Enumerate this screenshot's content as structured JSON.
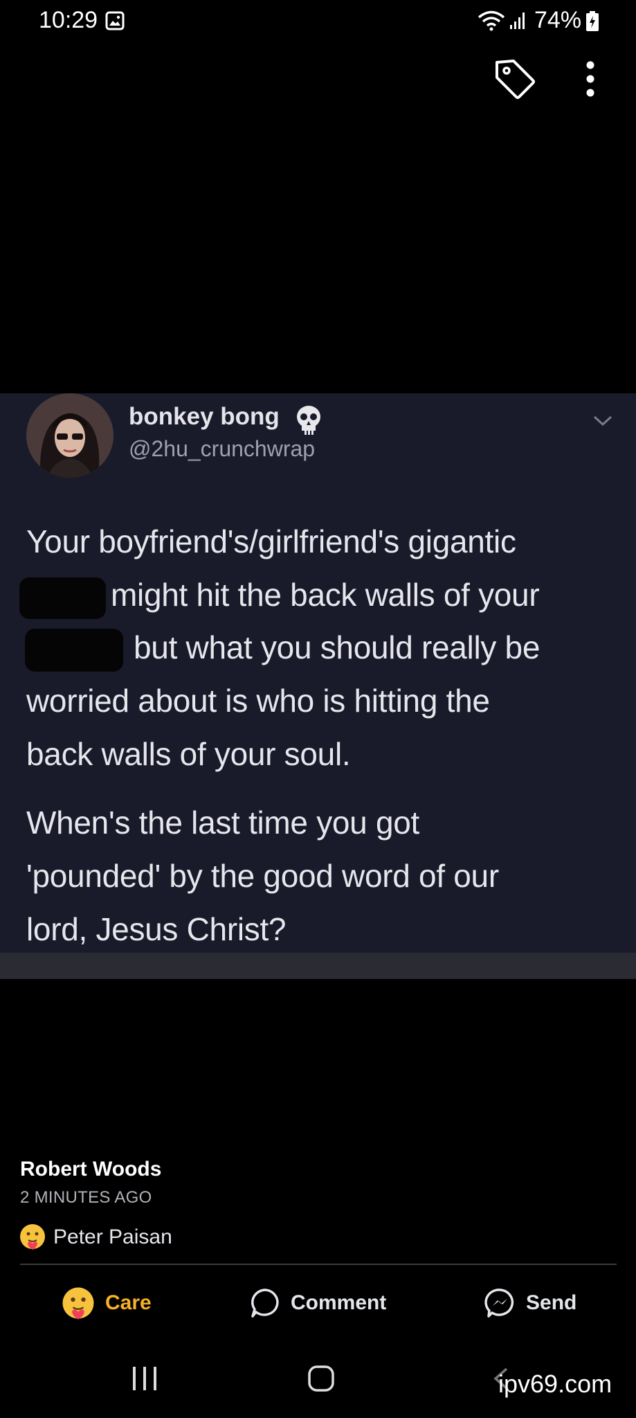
{
  "status_bar": {
    "time": "10:29",
    "battery": "74%"
  },
  "tweet": {
    "display_name": "bonkey bong",
    "handle": "@2hu_crunchwrap",
    "lines": [
      "Your boyfriend's/girlfriend's gigantic",
      "might hit the back walls of your",
      "but what you should really be",
      "worried about is who is hitting the",
      "back walls of your soul.",
      "When's the last time you got",
      "'pounded' by the good word of our",
      "lord, Jesus Christ?"
    ]
  },
  "post": {
    "author": "Robert Woods",
    "time": "2 MINUTES AGO",
    "reactor": "Peter Paisan"
  },
  "actions": {
    "care": "Care",
    "comment": "Comment",
    "send": "Send"
  },
  "watermark": "ipv69.com",
  "colors": {
    "care_accent": "#f7b125",
    "tweet_background": "#1a1b2a"
  }
}
